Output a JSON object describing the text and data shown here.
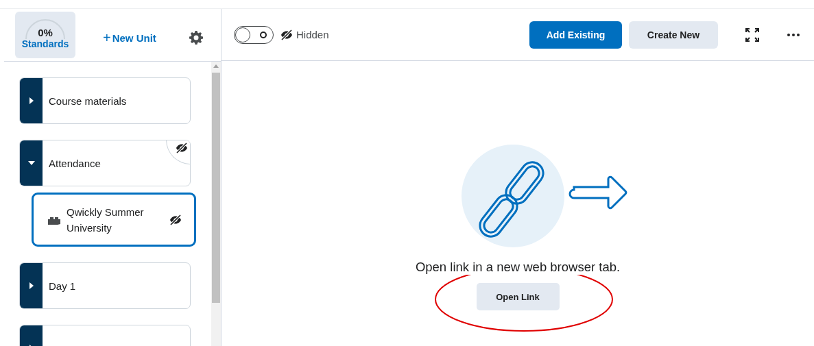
{
  "sidebar": {
    "standards": {
      "percent": "0%",
      "label": "Standards"
    },
    "new_unit": {
      "icon": "+",
      "label": "New Unit"
    },
    "items": [
      {
        "kind": "unit",
        "title": "Course materials",
        "expanded": false,
        "hidden": false,
        "selected": false
      },
      {
        "kind": "unit",
        "title": "Attendance",
        "expanded": true,
        "hidden": true,
        "selected": false,
        "children": [
          {
            "kind": "topic",
            "title": "Qwickly Summer University",
            "hidden": true,
            "selected": true
          }
        ]
      },
      {
        "kind": "unit",
        "title": "Day 1",
        "expanded": false,
        "hidden": false,
        "selected": false
      },
      {
        "kind": "unit",
        "expanded": false,
        "hidden": false,
        "selected": false
      }
    ]
  },
  "toolbar": {
    "visibility": {
      "on": false,
      "label": "Hidden"
    },
    "buttons": [
      {
        "label": "Add Existing",
        "kind": "primary"
      },
      {
        "label": "Create New",
        "kind": "secondary"
      }
    ]
  },
  "content": {
    "message": "Open link in a new web browser tab.",
    "button": "Open Link"
  }
}
